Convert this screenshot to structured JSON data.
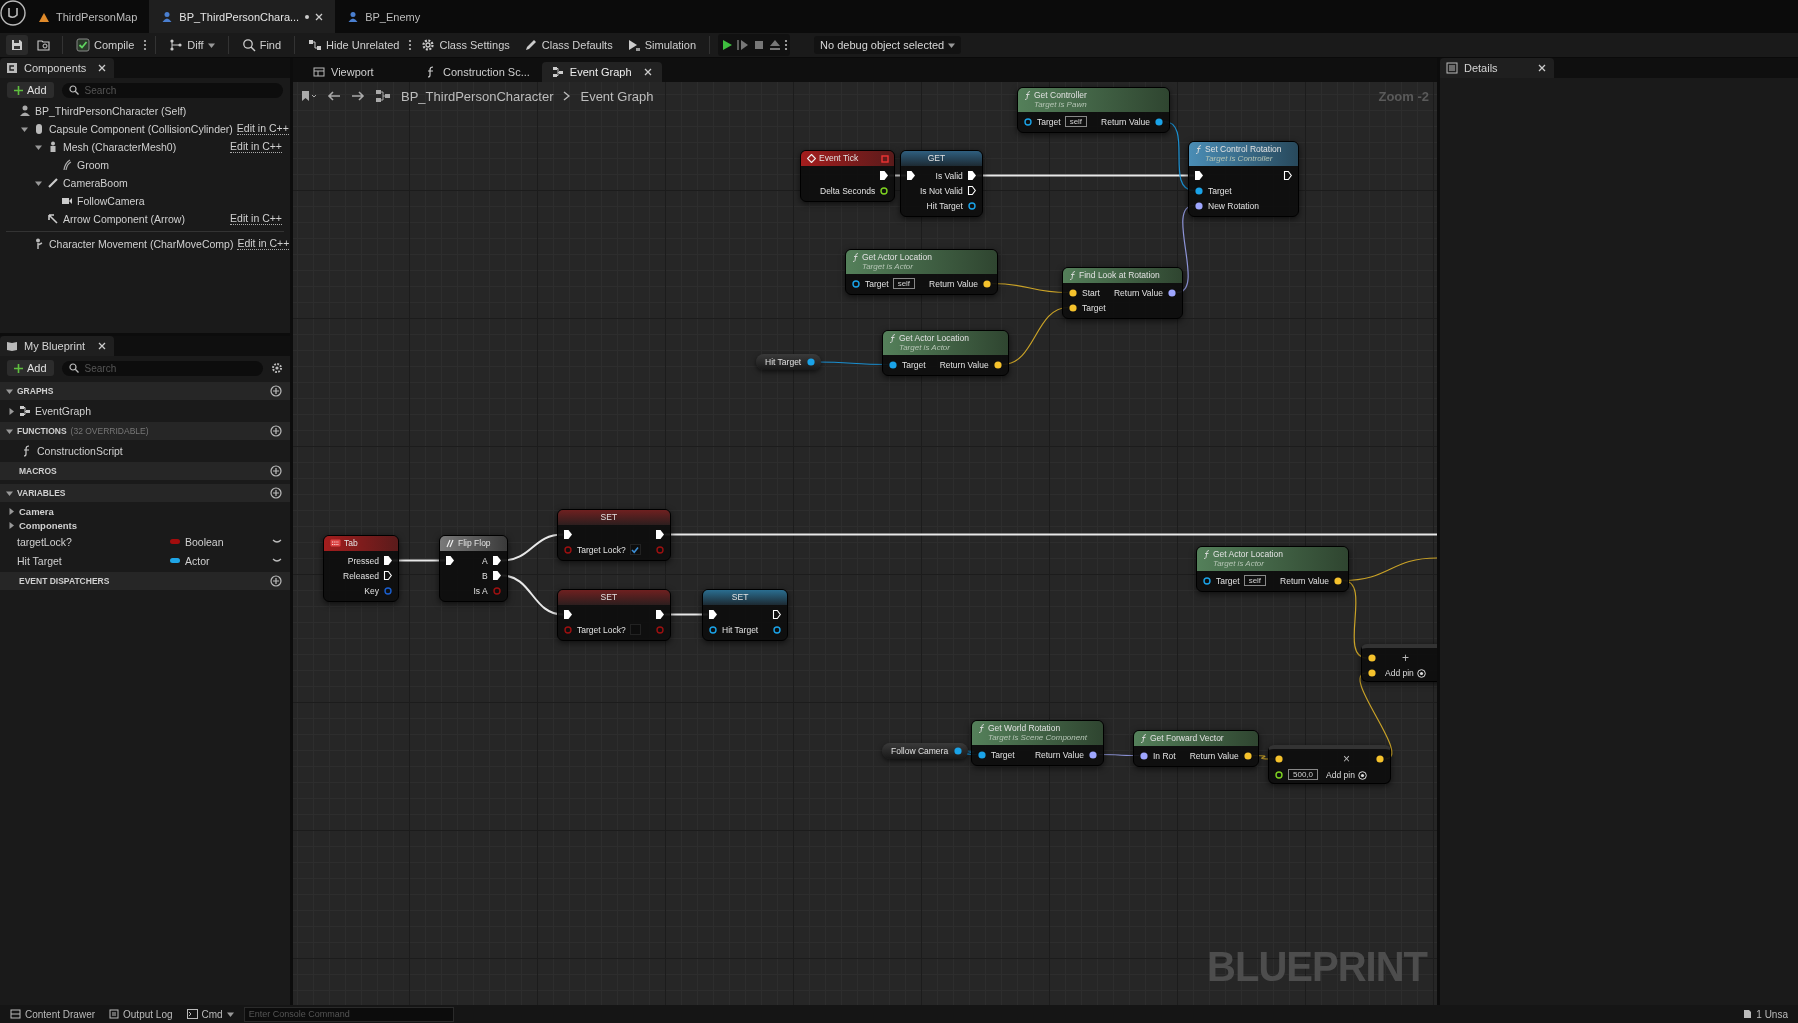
{
  "tabs": [
    {
      "label": "ThirdPersonMap",
      "selected": false,
      "modified": false
    },
    {
      "label": "BP_ThirdPersonChara...",
      "selected": true,
      "modified": true
    },
    {
      "label": "BP_Enemy",
      "selected": false,
      "modified": false
    }
  ],
  "toolbar": {
    "buttons": [
      {
        "label": "Compile",
        "kind": "compile",
        "menu": true
      },
      {
        "label": "Diff",
        "kind": "diff",
        "dropdown": true
      },
      {
        "label": "Find",
        "kind": "find"
      },
      {
        "label": "Hide Unrelated",
        "kind": "hide",
        "menu": true
      },
      {
        "label": "Class Settings",
        "kind": "settings"
      },
      {
        "label": "Class Defaults",
        "kind": "defaults"
      },
      {
        "label": "Simulation",
        "kind": "simulation"
      }
    ],
    "debug_selector": "No debug object selected"
  },
  "components": {
    "title": "Components",
    "add": "Add",
    "search_placeholder": "Search",
    "tree": [
      {
        "label": "BP_ThirdPersonCharacter (Self)",
        "children": [
          {
            "label": "Capsule Component (CollisionCylinder)",
            "edit": "Edit in C++",
            "expanded": true,
            "children": [
              {
                "label": "Mesh (CharacterMesh0)",
                "edit": "Edit in C++",
                "expanded": true,
                "children": [
                  {
                    "label": "Groom"
                  }
                ]
              },
              {
                "label": "CameraBoom",
                "expanded": true,
                "children": [
                  {
                    "label": "FollowCamera"
                  }
                ]
              },
              {
                "label": "Arrow Component (Arrow)",
                "edit": "Edit in C++"
              }
            ]
          },
          {
            "label": "Character Movement (CharMoveComp)",
            "edit": "Edit in C++"
          }
        ]
      }
    ]
  },
  "my_blueprint": {
    "title": "My Blueprint",
    "add": "Add",
    "search_placeholder": "Search",
    "sections": [
      {
        "title": "GRAPHS",
        "expanded": true,
        "items": [
          {
            "label": "EventGraph",
            "expanded": false
          }
        ]
      },
      {
        "title": "FUNCTIONS",
        "note": "(32 OVERRIDABLE)",
        "expanded": true,
        "items": [
          {
            "label": "ConstructionScript"
          }
        ]
      },
      {
        "title": "MACROS"
      },
      {
        "title": "VARIABLES",
        "expanded": true,
        "categories": [
          {
            "label": "Camera",
            "expanded": false
          },
          {
            "label": "Components",
            "expanded": false
          }
        ],
        "variables": [
          {
            "name": "targetLock?",
            "type": "Boolean",
            "color": "#a30d0d"
          },
          {
            "name": "Hit Target",
            "type": "Actor",
            "color": "#1fa5e6"
          }
        ]
      },
      {
        "title": "EVENT DISPATCHERS"
      }
    ]
  },
  "graph_tabs": [
    {
      "label": "Viewport",
      "kind": "viewport",
      "selected": false
    },
    {
      "label": "Construction Sc...",
      "kind": "function",
      "selected": false
    },
    {
      "label": "Event Graph",
      "kind": "graph",
      "selected": true
    }
  ],
  "breadcrumb": [
    "BP_ThirdPersonCharacter",
    "Event Graph"
  ],
  "zoom_label": "Zoom -2",
  "watermark": "BLUEPRINT",
  "nodes": [
    {
      "kind": "pure-function",
      "title": "Get Controller",
      "subtitle": "Target is Pawn",
      "rows": [
        {
          "left": {
            "kind": "object",
            "label": "Target",
            "value": "self",
            "connected": false
          },
          "right": {
            "kind": "object",
            "label": "Return Value",
            "connected": true
          }
        }
      ]
    },
    {
      "kind": "event",
      "title": "Event Tick",
      "rows": [
        {
          "right": {
            "kind": "exec",
            "connected": true
          }
        },
        {
          "right": {
            "kind": "float",
            "label": "Delta Seconds",
            "connected": false
          }
        }
      ]
    },
    {
      "kind": "get",
      "title": "GET",
      "rows": [
        {
          "left": {
            "kind": "exec",
            "connected": true
          },
          "right": {
            "kind": "exec",
            "label": "Is Valid",
            "connected": true
          }
        },
        {
          "right": {
            "kind": "exec",
            "label": "Is Not Valid",
            "connected": false
          }
        },
        {
          "right": {
            "kind": "object",
            "label": "Hit Target",
            "connected": false
          }
        }
      ]
    },
    {
      "kind": "function",
      "title": "Set Control Rotation",
      "subtitle": "Target is Controller",
      "rows": [
        {
          "left": {
            "kind": "exec",
            "connected": true
          },
          "right": {
            "kind": "exec",
            "connected": false
          }
        },
        {
          "left": {
            "kind": "object",
            "label": "Target",
            "connected": true
          }
        },
        {
          "left": {
            "kind": "rotator",
            "label": "New Rotation",
            "connected": true
          }
        }
      ]
    },
    {
      "kind": "pure-function",
      "title": "Get Actor Location",
      "subtitle": "Target is Actor",
      "rows": [
        {
          "left": {
            "kind": "object",
            "label": "Target",
            "value": "self",
            "connected": false
          },
          "right": {
            "kind": "vector",
            "label": "Return Value",
            "connected": true
          }
        }
      ]
    },
    {
      "kind": "pure-function",
      "title": "Find Look at Rotation",
      "rows": [
        {
          "left": {
            "kind": "vector",
            "label": "Start",
            "connected": true
          },
          "right": {
            "kind": "rotator",
            "label": "Return Value",
            "connected": true
          }
        },
        {
          "left": {
            "kind": "vector",
            "label": "Target",
            "connected": true
          }
        }
      ]
    },
    {
      "kind": "variable",
      "title": "Hit Target",
      "rows": [
        {
          "right": {
            "kind": "object",
            "connected": true
          }
        }
      ]
    },
    {
      "kind": "pure-function",
      "title": "Get Actor Location",
      "subtitle": "Target is Actor",
      "rows": [
        {
          "left": {
            "kind": "object",
            "label": "Target",
            "connected": true
          },
          "right": {
            "kind": "vector",
            "label": "Return Value",
            "connected": true
          }
        }
      ]
    },
    {
      "kind": "input-event",
      "title": "Tab",
      "rows": [
        {
          "right": {
            "kind": "exec",
            "label": "Pressed",
            "connected": true
          }
        },
        {
          "right": {
            "kind": "exec",
            "label": "Released",
            "connected": false
          }
        },
        {
          "right": {
            "kind": "struct",
            "label": "Key",
            "connected": false
          }
        }
      ]
    },
    {
      "kind": "macro",
      "title": "Flip Flop",
      "rows": [
        {
          "left": {
            "kind": "exec",
            "connected": true
          },
          "right": {
            "kind": "exec",
            "label": "A",
            "connected": true
          }
        },
        {
          "right": {
            "kind": "exec",
            "label": "B",
            "connected": true
          }
        },
        {
          "right": {
            "kind": "bool",
            "label": "Is A",
            "connected": false
          }
        }
      ]
    },
    {
      "kind": "set",
      "title": "SET",
      "rows": [
        {
          "left": {
            "kind": "exec",
            "connected": true
          },
          "right": {
            "kind": "exec",
            "connected": true
          }
        },
        {
          "left": {
            "kind": "bool",
            "label": "Target Lock?",
            "checked": true,
            "connected": false
          },
          "right": {
            "kind": "bool",
            "connected": false
          }
        }
      ]
    },
    {
      "kind": "set",
      "title": "SET",
      "rows": [
        {
          "left": {
            "kind": "exec",
            "connected": true
          },
          "right": {
            "kind": "exec",
            "connected": true
          }
        },
        {
          "left": {
            "kind": "bool",
            "label": "Target Lock?",
            "checked": false,
            "connected": false
          },
          "right": {
            "kind": "bool",
            "connected": false
          }
        }
      ]
    },
    {
      "kind": "set",
      "title": "SET",
      "rows": [
        {
          "left": {
            "kind": "exec",
            "connected": true
          },
          "right": {
            "kind": "exec",
            "connected": false
          }
        },
        {
          "left": {
            "kind": "object",
            "label": "Hit Target",
            "connected": false
          },
          "right": {
            "kind": "object",
            "connected": false
          }
        }
      ]
    },
    {
      "kind": "pure-function",
      "title": "Get Actor Location",
      "subtitle": "Target is Actor",
      "rows": [
        {
          "left": {
            "kind": "object",
            "label": "Target",
            "value": "self",
            "connected": false
          },
          "right": {
            "kind": "vector",
            "label": "Return Value",
            "connected": true
          }
        }
      ]
    },
    {
      "kind": "math",
      "symbol": "+",
      "add_pin": "Add pin",
      "rows": [
        {
          "left": {
            "kind": "vector",
            "connected": true
          }
        },
        {
          "left": {
            "kind": "vector",
            "connected": true
          }
        }
      ]
    },
    {
      "kind": "variable",
      "title": "Follow Camera",
      "rows": [
        {
          "right": {
            "kind": "object",
            "connected": true
          }
        }
      ]
    },
    {
      "kind": "pure-function",
      "title": "Get World Rotation",
      "subtitle": "Target is Scene Component",
      "rows": [
        {
          "left": {
            "kind": "object",
            "label": "Target",
            "connected": true
          },
          "right": {
            "kind": "rotator",
            "label": "Return Value",
            "connected": true
          }
        }
      ]
    },
    {
      "kind": "pure-function",
      "title": "Get Forward Vector",
      "rows": [
        {
          "left": {
            "kind": "rotator",
            "label": "In Rot",
            "connected": true
          },
          "right": {
            "kind": "vector",
            "label": "Return Value",
            "connected": true
          }
        }
      ]
    },
    {
      "kind": "math",
      "symbol": "×",
      "add_pin": "Add pin",
      "rows": [
        {
          "left": {
            "kind": "vector",
            "connected": true
          },
          "right": {
            "kind": "vector",
            "connected": true
          }
        },
        {
          "left": {
            "kind": "float",
            "value": "500,0",
            "connected": false
          }
        }
      ]
    }
  ],
  "details": {
    "title": "Details"
  },
  "status_bar": {
    "content_drawer": "Content Drawer",
    "output_log": "Output Log",
    "cmd": "Cmd",
    "console_placeholder": "Enter Console Command",
    "unsaved": "1 Unsa"
  }
}
